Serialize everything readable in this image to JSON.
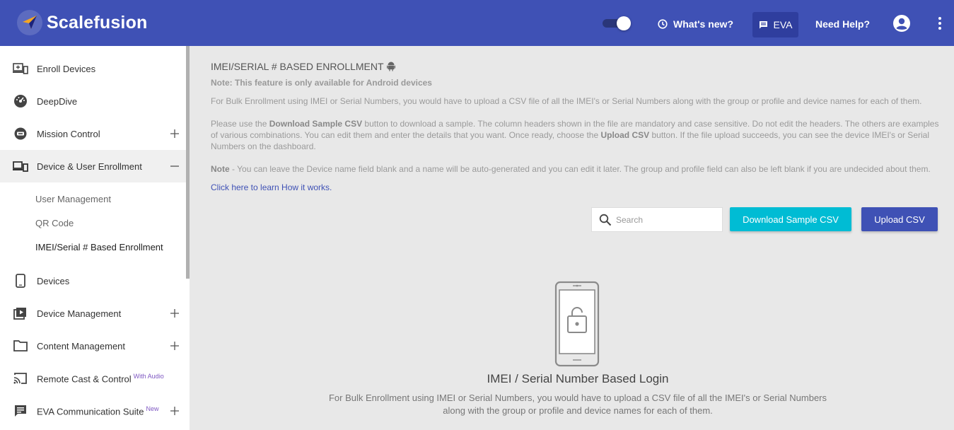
{
  "header": {
    "brand": "Scalefusion",
    "whats_new": "What's new?",
    "eva": "EVA",
    "need_help": "Need Help?",
    "toggle_on": true
  },
  "sidebar": {
    "items": [
      {
        "label": "Enroll Devices",
        "icon": "enroll-devices-icon"
      },
      {
        "label": "DeepDive",
        "icon": "dashboard-gauge-icon"
      },
      {
        "label": "Mission Control",
        "icon": "mission-control-icon",
        "expand": "+"
      },
      {
        "label": "Device & User Enrollment",
        "icon": "devices-enrollment-icon",
        "expand": "−"
      },
      {
        "label": "Devices",
        "icon": "phone-icon"
      },
      {
        "label": "Device Management",
        "icon": "device-management-icon",
        "expand": "+"
      },
      {
        "label": "Content Management",
        "icon": "folder-icon",
        "expand": "+"
      },
      {
        "label": "Remote Cast & Control",
        "icon": "cast-icon",
        "badge": "With Audio"
      },
      {
        "label": "EVA Communication Suite",
        "icon": "chat-icon",
        "badge": "New",
        "expand": "+"
      }
    ],
    "subitems": [
      {
        "label": "User Management"
      },
      {
        "label": "QR Code"
      },
      {
        "label": "IMEI/Serial # Based Enrollment"
      }
    ]
  },
  "main": {
    "title": "IMEI/SERIAL # BASED ENROLLMENT",
    "note": "Note: This feature is only available for Android devices",
    "para1": "For Bulk Enrollment using IMEI or Serial Numbers, you would have to upload a CSV file of all the IMEI's or Serial Numbers along with the group or profile and device names for each of them.",
    "para2": {
      "t1": "Please use the ",
      "b1": "Download Sample CSV",
      "t2": " button to download a sample. The column headers shown in the file are mandatory and case sensitive. Do not edit the headers. The others are examples of various combinations. You can edit them and enter the details that you want. Once ready, choose the ",
      "b2": "Upload CSV",
      "t3": " button. If the file upload succeeds, you can see the device IMEI's or Serial Numbers on the dashboard."
    },
    "para3": {
      "b": "Note",
      "t": " - You can leave the Device name field blank and a name will be auto-generated and you can edit it later. The group and profile field can also be left blank if you are undecided about them."
    },
    "link": "Click here to learn How it works.",
    "search_placeholder": "Search",
    "download_btn": "Download Sample CSV",
    "upload_btn": "Upload CSV",
    "empty_title": "IMEI / Serial Number Based Login",
    "empty_desc_line1": "For Bulk Enrollment using IMEI or Serial Numbers, you would have to upload a CSV file of all the IMEI's or Serial Numbers",
    "empty_desc_line2": "along with the group or profile and device names for each of them."
  },
  "colors": {
    "header_bg": "#3f51b5",
    "download_btn": "#00bcd4",
    "upload_btn": "#3f51b5",
    "link": "#3f51b5"
  }
}
